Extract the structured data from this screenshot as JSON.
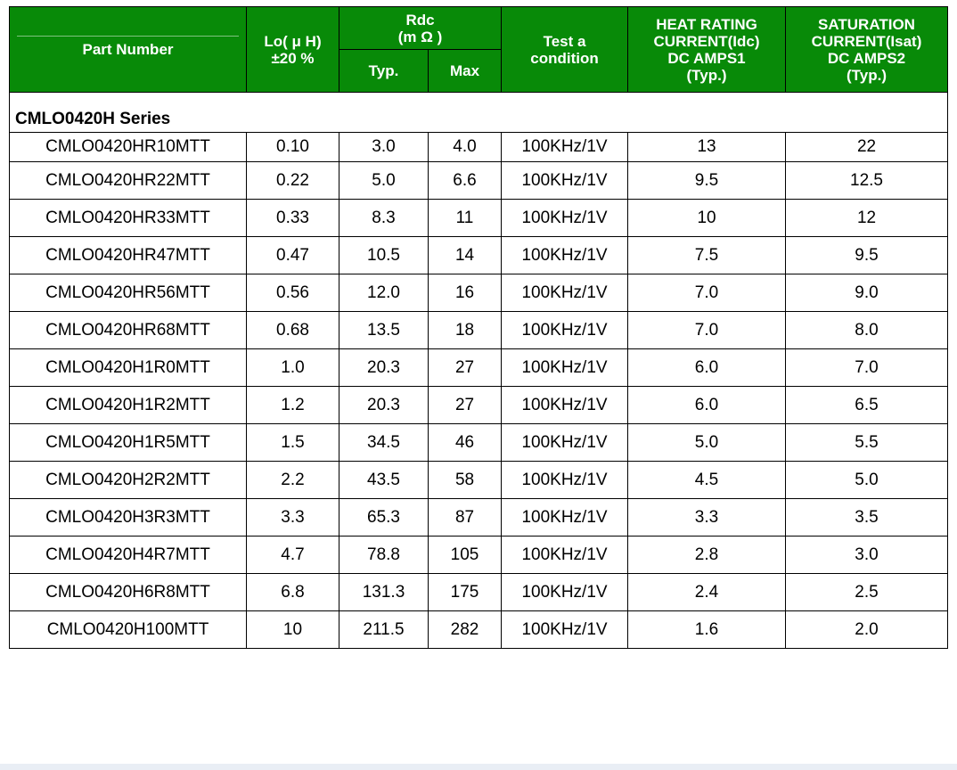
{
  "header_fragment": "",
  "table": {
    "headers": {
      "part_number": "Part Number",
      "lo_line1": "Lo( μ H)",
      "lo_line2": "±20 %",
      "rdc_line1": "Rdc",
      "rdc_line2": "(m Ω )",
      "rdc_typ": "Typ.",
      "rdc_max": "Max",
      "test_line1": "Test a",
      "test_line2": "condition",
      "heat_line1": "HEAT RATING",
      "heat_line2": "CURRENT(Idc)",
      "heat_line3": "DC AMPS1",
      "heat_line4": "(Typ.)",
      "sat_line1": "SATURATION",
      "sat_line2": "CURRENT(Isat)",
      "sat_line3": "DC AMPS2",
      "sat_line4": "(Typ.)"
    },
    "series_label": "CMLO0420H Series",
    "rows": [
      [
        "CMLO0420HR10MTT",
        "0.10",
        "3.0",
        "4.0",
        "100KHz/1V",
        "13",
        "22"
      ],
      [
        "CMLO0420HR22MTT",
        "0.22",
        "5.0",
        "6.6",
        "100KHz/1V",
        "9.5",
        "12.5"
      ],
      [
        "CMLO0420HR33MTT",
        "0.33",
        "8.3",
        "11",
        "100KHz/1V",
        "10",
        "12"
      ],
      [
        "CMLO0420HR47MTT",
        "0.47",
        "10.5",
        "14",
        "100KHz/1V",
        "7.5",
        "9.5"
      ],
      [
        "CMLO0420HR56MTT",
        "0.56",
        "12.0",
        "16",
        "100KHz/1V",
        "7.0",
        "9.0"
      ],
      [
        "CMLO0420HR68MTT",
        "0.68",
        "13.5",
        "18",
        "100KHz/1V",
        "7.0",
        "8.0"
      ],
      [
        "CMLO0420H1R0MTT",
        "1.0",
        "20.3",
        "27",
        "100KHz/1V",
        "6.0",
        "7.0"
      ],
      [
        "CMLO0420H1R2MTT",
        "1.2",
        "20.3",
        "27",
        "100KHz/1V",
        "6.0",
        "6.5"
      ],
      [
        "CMLO0420H1R5MTT",
        "1.5",
        "34.5",
        "46",
        "100KHz/1V",
        "5.0",
        "5.5"
      ],
      [
        "CMLO0420H2R2MTT",
        "2.2",
        "43.5",
        "58",
        "100KHz/1V",
        "4.5",
        "5.0"
      ],
      [
        "CMLO0420H3R3MTT",
        "3.3",
        "65.3",
        "87",
        "100KHz/1V",
        "3.3",
        "3.5"
      ],
      [
        "CMLO0420H4R7MTT",
        "4.7",
        "78.8",
        "105",
        "100KHz/1V",
        "2.8",
        "3.0"
      ],
      [
        "CMLO0420H6R8MTT",
        "6.8",
        "131.3",
        "175",
        "100KHz/1V",
        "2.4",
        "2.5"
      ],
      [
        "CMLO0420H100MTT",
        "10",
        "211.5",
        "282",
        "100KHz/1V",
        "1.6",
        "2.0"
      ]
    ]
  },
  "colors": {
    "header_green": "#088a08",
    "header_text": "#ffffff",
    "border": "#000000"
  }
}
